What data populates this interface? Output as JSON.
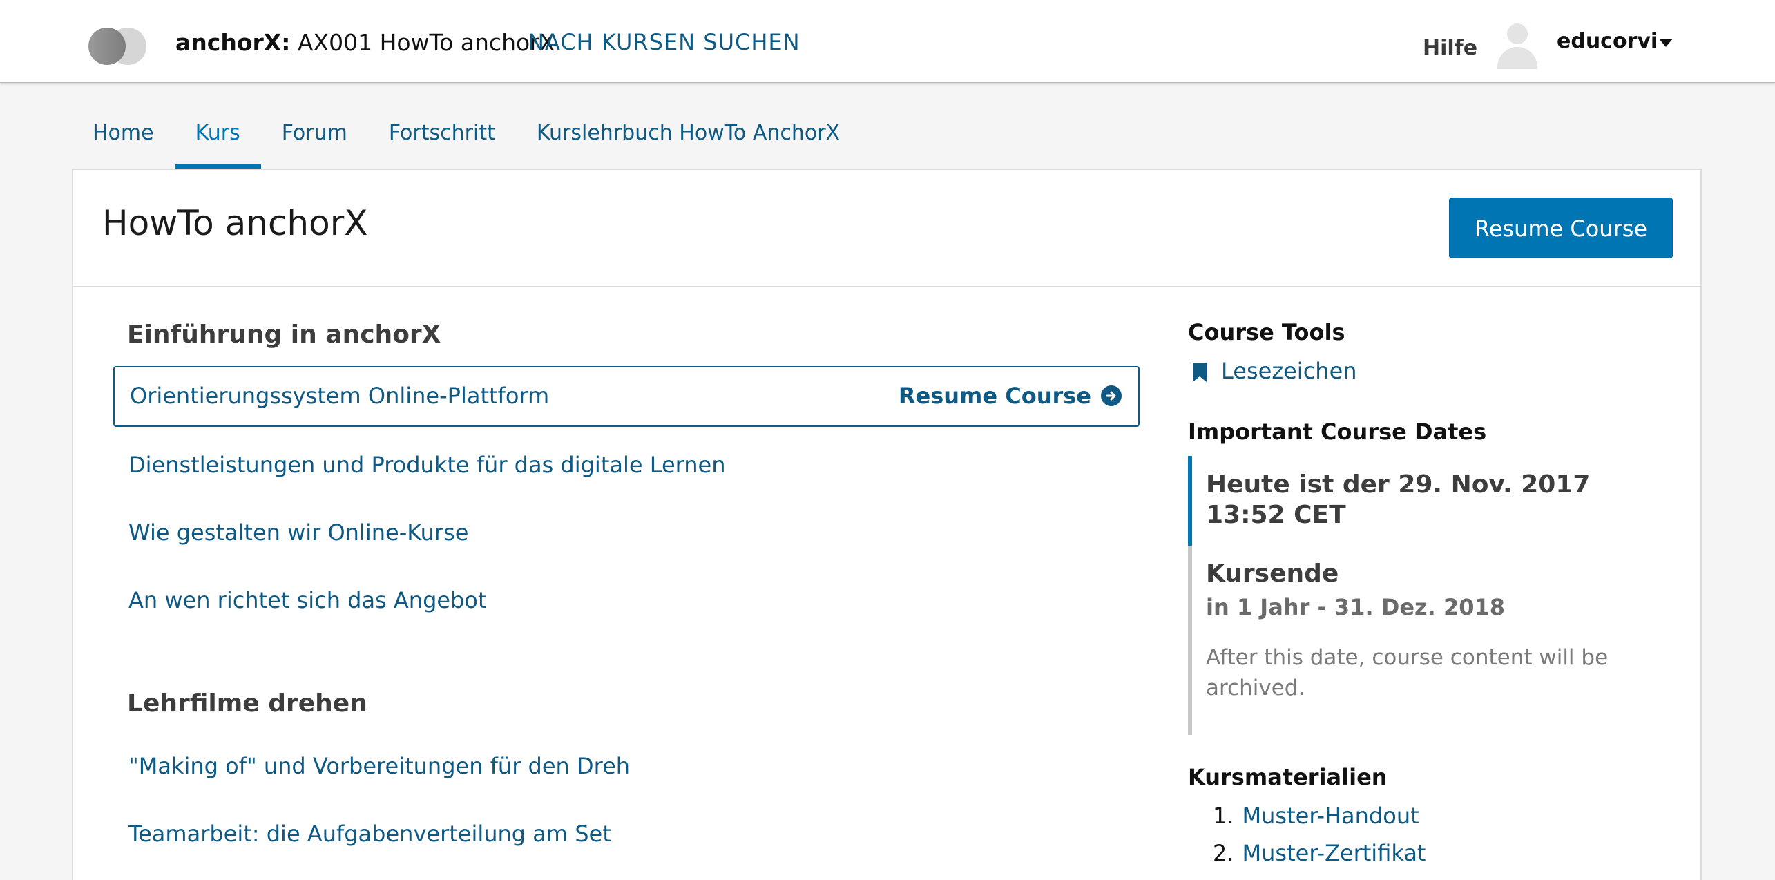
{
  "header": {
    "org": "anchorX:",
    "course": "AX001 HowTo anchorX",
    "search_link": "NACH KURSEN SUCHEN",
    "help": "Hilfe",
    "username": "educorvi"
  },
  "tabs": [
    {
      "label": "Home"
    },
    {
      "label": "Kurs"
    },
    {
      "label": "Forum"
    },
    {
      "label": "Fortschritt"
    },
    {
      "label": "Kurslehrbuch HowTo AnchorX"
    }
  ],
  "main": {
    "title": "HowTo anchorX",
    "resume_button": "Resume Course",
    "sections": [
      {
        "title": "Einführung in anchorX",
        "units": [
          "Orientierungssystem Online-Plattform",
          "Dienstleistungen und Produkte für das digitale Lernen",
          "Wie gestalten wir Online-Kurse",
          "An wen richtet sich das Angebot"
        ],
        "active_resume": "Resume Course"
      },
      {
        "title": "Lehrfilme drehen",
        "units": [
          "\"Making of\" und Vorbereitungen für den Dreh",
          "Teamarbeit: die Aufgabenverteilung am Set"
        ]
      }
    ]
  },
  "sidebar": {
    "tools_title": "Course Tools",
    "bookmark_link": "Lesezeichen",
    "dates_title": "Important Course Dates",
    "today": "Heute ist der 29. Nov. 2017 13:52 CET",
    "end_title": "Kursende",
    "end_date": "in 1 Jahr - 31. Dez. 2018",
    "end_note": "After this date, course content will be archived.",
    "materials_title": "Kursmaterialien",
    "materials": [
      {
        "num": "1.",
        "label": "Muster-Handout"
      },
      {
        "num": "2.",
        "label": "Muster-Zertifikat"
      }
    ]
  },
  "colors": {
    "accent": "#0075b4",
    "link": "#0e5a84"
  }
}
